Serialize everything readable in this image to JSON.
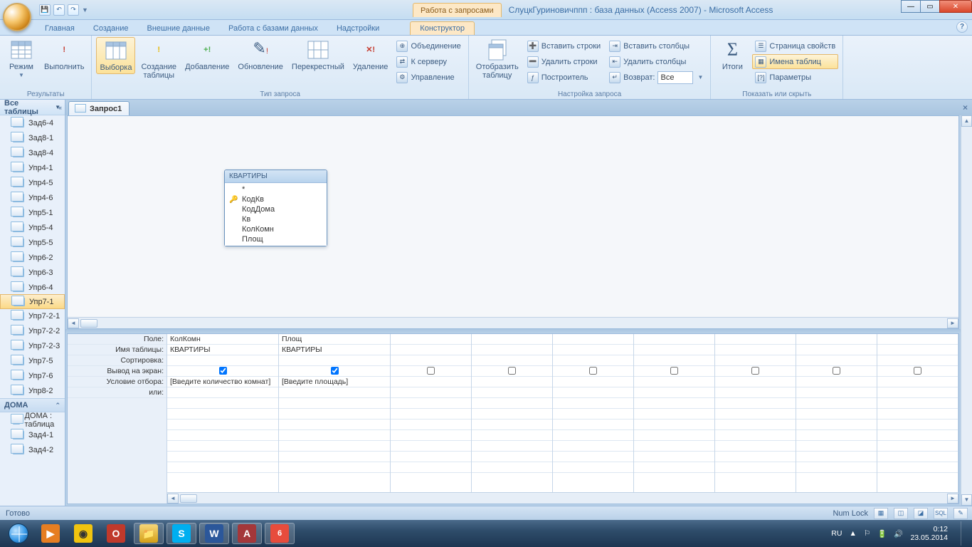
{
  "title": {
    "context_tab": "Работа с запросами",
    "text": "СлуцкГуриновичппп : база данных (Access 2007) - Microsoft Access"
  },
  "menu_tabs": [
    "Главная",
    "Создание",
    "Внешние данные",
    "Работа с базами данных",
    "Надстройки"
  ],
  "context_menu_tab": "Конструктор",
  "ribbon": {
    "g1_label": "Результаты",
    "g1_btn1": "Режим",
    "g1_btn2": "Выполнить",
    "g2_label": "Тип запроса",
    "g2_b1": "Выборка",
    "g2_b2a": "Создание",
    "g2_b2b": "таблицы",
    "g2_b3": "Добавление",
    "g2_b4": "Обновление",
    "g2_b5": "Перекрестный",
    "g2_b6": "Удаление",
    "g2_s1": "Объединение",
    "g2_s2": "К серверу",
    "g2_s3": "Управление",
    "g3_label": "Настройка запроса",
    "g3_b1a": "Отобразить",
    "g3_b1b": "таблицу",
    "g3_s1": "Вставить строки",
    "g3_s2": "Удалить строки",
    "g3_s3": "Построитель",
    "g3_s4": "Вставить столбцы",
    "g3_s5": "Удалить столбцы",
    "g3_s6": "Возврат:",
    "g3_ret": "Все",
    "g4_label": "Показать или скрыть",
    "g4_b1": "Итоги",
    "g4_s1": "Страница свойств",
    "g4_s2": "Имена таблиц",
    "g4_s3": "Параметры"
  },
  "nav": {
    "header": "Все таблицы",
    "items": [
      "Зад6-4",
      "Зад8-1",
      "Зад8-4",
      "Упр4-1",
      "Упр4-5",
      "Упр4-6",
      "Упр5-1",
      "Упр5-4",
      "Упр5-5",
      "Упр6-2",
      "Упр6-3",
      "Упр6-4",
      "Упр7-1",
      "Упр7-2-1",
      "Упр7-2-2",
      "Упр7-2-3",
      "Упр7-5",
      "Упр7-6",
      "Упр8-2"
    ],
    "selected_index": 12,
    "group2_header": "ДОМА",
    "group2_items": [
      "ДОМА : таблица",
      "Зад4-1",
      "Зад4-2"
    ]
  },
  "doc": {
    "tab": "Запрос1",
    "table": {
      "name": "КВАРТИРЫ",
      "fields": [
        "*",
        "КодКв",
        "КодДома",
        "Кв",
        "КолКомн",
        "Площ"
      ],
      "key_index": 1
    },
    "grid": {
      "row_labels": [
        "Поле:",
        "Имя таблицы:",
        "Сортировка:",
        "Вывод на экран:",
        "Условие отбора:",
        "или:"
      ],
      "cols": [
        {
          "field": "КолКомн",
          "table": "КВАРТИРЫ",
          "sort": "",
          "show": true,
          "criteria": "[Введите количество комнат]",
          "or": ""
        },
        {
          "field": "Площ",
          "table": "КВАРТИРЫ",
          "sort": "",
          "show": true,
          "criteria": "[Введите площадь]",
          "or": ""
        },
        {
          "field": "",
          "table": "",
          "sort": "",
          "show": false,
          "criteria": "",
          "or": ""
        },
        {
          "field": "",
          "table": "",
          "sort": "",
          "show": false,
          "criteria": "",
          "or": ""
        },
        {
          "field": "",
          "table": "",
          "sort": "",
          "show": false,
          "criteria": "",
          "or": ""
        },
        {
          "field": "",
          "table": "",
          "sort": "",
          "show": false,
          "criteria": "",
          "or": ""
        },
        {
          "field": "",
          "table": "",
          "sort": "",
          "show": false,
          "criteria": "",
          "or": ""
        },
        {
          "field": "",
          "table": "",
          "sort": "",
          "show": false,
          "criteria": "",
          "or": ""
        },
        {
          "field": "",
          "table": "",
          "sort": "",
          "show": false,
          "criteria": "",
          "or": ""
        }
      ]
    }
  },
  "status": {
    "ready": "Готово",
    "numlock": "Num Lock"
  },
  "tray": {
    "lang": "RU",
    "time": "0:12",
    "date": "23.05.2014"
  }
}
